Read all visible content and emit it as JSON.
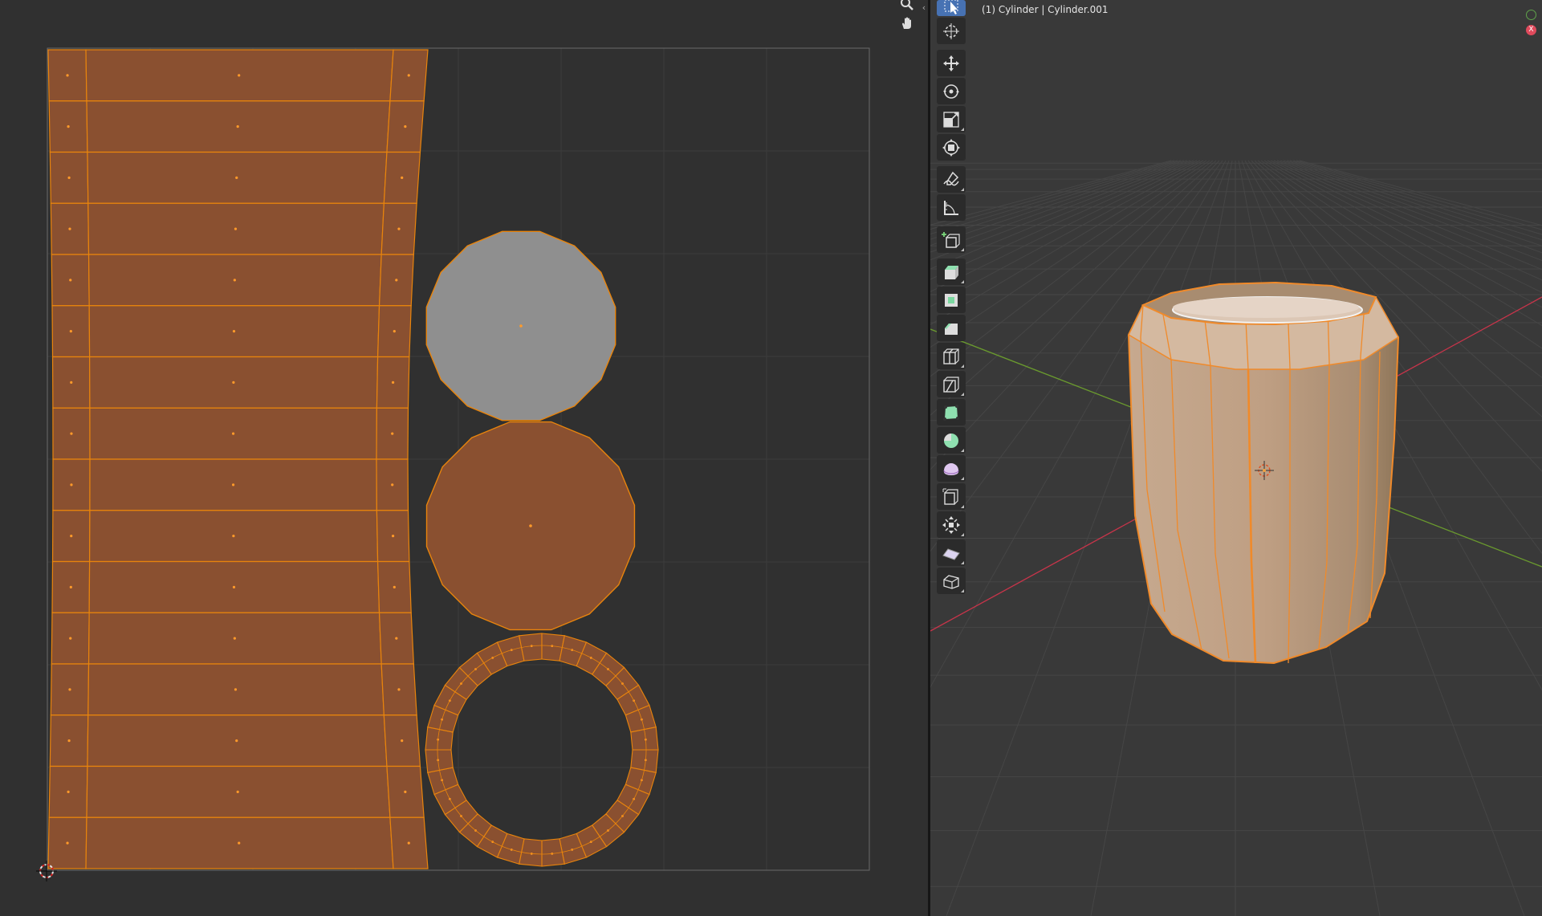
{
  "viewport": {
    "label": "(1) Cylinder | Cylinder.001",
    "gizmo_x_label": "X"
  },
  "uv_editor": {
    "nav_icons": [
      "zoom-icon",
      "hand-pan-icon"
    ]
  },
  "toolbar": {
    "tools": [
      {
        "name": "select-box-tool",
        "icon": "cursor-arrow-icon",
        "active": true
      },
      {
        "name": "cursor-tool",
        "icon": "3d-cursor-icon"
      },
      {
        "name": "move-tool",
        "icon": "move-arrows-icon"
      },
      {
        "name": "rotate-tool",
        "icon": "rotate-icon"
      },
      {
        "name": "scale-tool",
        "icon": "scale-icon"
      },
      {
        "name": "transform-tool",
        "icon": "transform-icon"
      },
      {
        "name": "annotate-tool",
        "icon": "pencil-icon"
      },
      {
        "name": "measure-tool",
        "icon": "ruler-icon"
      },
      {
        "name": "add-cube-tool",
        "icon": "add-cube-icon"
      },
      {
        "name": "extrude-region-tool",
        "icon": "extrude-icon"
      },
      {
        "name": "inset-faces-tool",
        "icon": "inset-icon"
      },
      {
        "name": "bevel-tool",
        "icon": "bevel-icon"
      },
      {
        "name": "loop-cut-tool",
        "icon": "loop-cut-icon"
      },
      {
        "name": "knife-tool",
        "icon": "knife-icon"
      },
      {
        "name": "poly-build-tool",
        "icon": "poly-build-icon"
      },
      {
        "name": "spin-tool",
        "icon": "spin-icon"
      },
      {
        "name": "smooth-tool",
        "icon": "smooth-icon"
      },
      {
        "name": "edge-slide-tool",
        "icon": "edge-slide-icon"
      },
      {
        "name": "shrink-fatten-tool",
        "icon": "shrink-fatten-icon"
      },
      {
        "name": "shear-tool",
        "icon": "shear-icon"
      },
      {
        "name": "rip-region-tool",
        "icon": "rip-icon"
      }
    ]
  },
  "colors": {
    "uv_face": "#8a5030",
    "uv_edge": "#e8840c",
    "uv_face_unselected": "#8f8f8f",
    "mesh_face": "#c7a88c",
    "mesh_edge": "#f08a2a",
    "active_tool": "#4772b3",
    "axis_x": "#c8344a",
    "axis_y": "#6a9a2e"
  }
}
